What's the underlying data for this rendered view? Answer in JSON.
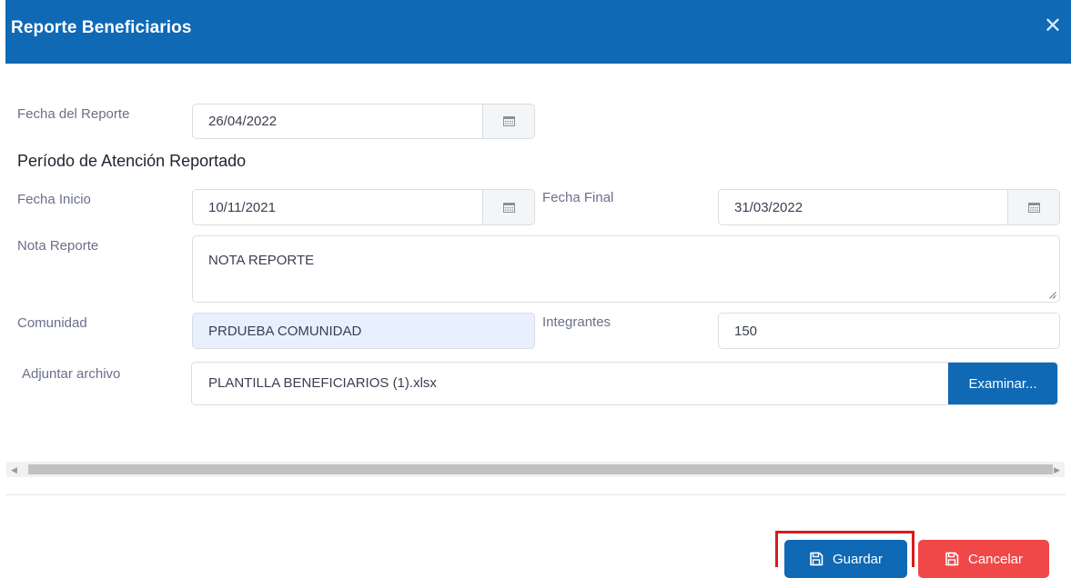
{
  "dialog": {
    "title": "Reporte Beneficiarios",
    "close_glyph": "✕",
    "accent_color": "#0f69b4",
    "danger_color": "#f04848"
  },
  "form": {
    "fecha_reporte": {
      "label": "Fecha del Reporte",
      "value": "26/04/2022",
      "icon": "calendar-icon"
    },
    "section_title": "Período de Atención Reportado",
    "fecha_inicio": {
      "label": "Fecha Inicio",
      "value": "10/11/2021",
      "icon": "calendar-icon"
    },
    "fecha_final": {
      "label": "Fecha Final",
      "value": "31/03/2022",
      "icon": "calendar-icon"
    },
    "nota_reporte": {
      "label": "Nota Reporte",
      "value": "NOTA REPORTE"
    },
    "comunidad": {
      "label": "Comunidad",
      "value": "PRDUEBA COMUNIDAD"
    },
    "integrantes": {
      "label": "Integrantes",
      "value": "150"
    },
    "adjuntar": {
      "label": "Adjuntar archivo",
      "file_name": "PLANTILLA BENEFICIARIOS (1).xlsx",
      "browse_label": "Examinar..."
    }
  },
  "footer": {
    "guardar_label": "Guardar",
    "cancelar_label": "Cancelar",
    "icon": "save-icon"
  }
}
